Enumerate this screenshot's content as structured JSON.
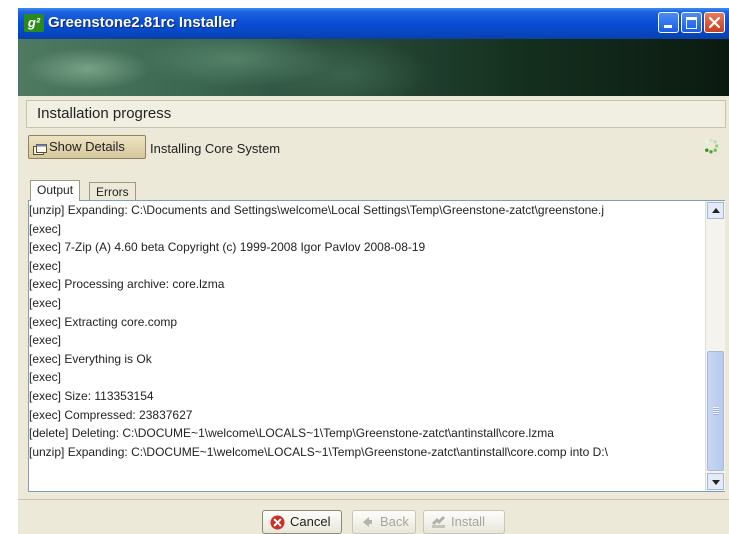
{
  "window": {
    "title": "Greenstone2.81rc Installer",
    "app_icon_text": "g²"
  },
  "heading": "Installation progress",
  "details_button_label": "Show Details",
  "status_text": "Installing Core System",
  "tabs": [
    {
      "label": "Output",
      "selected": true
    },
    {
      "label": "Errors",
      "selected": false
    }
  ],
  "log_lines": [
    "[unzip] Expanding: C:\\Documents and Settings\\welcome\\Local Settings\\Temp\\Greenstone-zatct\\greenstone.j",
    "  [exec]",
    "  [exec] 7-Zip (A)  4.60 beta  Copyright (c) 1999-2008 Igor Pavlov  2008-08-19",
    "  [exec]",
    "  [exec] Processing archive: core.lzma",
    "  [exec]",
    "  [exec] Extracting  core.comp",
    "  [exec]",
    "  [exec] Everything is Ok",
    "  [exec]",
    "  [exec] Size:      113353154",
    "  [exec] Compressed: 23837627",
    " [delete] Deleting: C:\\DOCUME~1\\welcome\\LOCALS~1\\Temp\\Greenstone-zatct\\antinstall\\core.lzma",
    "  [unzip] Expanding: C:\\DOCUME~1\\welcome\\LOCALS~1\\Temp\\Greenstone-zatct\\antinstall\\core.comp into D:\\"
  ],
  "buttons": {
    "cancel": "Cancel",
    "back": "Back",
    "install": "Install"
  },
  "colors": {
    "titlebar": "#0a4fd6",
    "cancel_icon": "#c8302a",
    "disabled_text": "#a6a6a0"
  },
  "icons": {
    "details": "details-window-icon",
    "spinner": "busy-spinner-icon",
    "cancel": "cancel-x-icon",
    "back": "back-arrow-icon",
    "install": "install-icon"
  }
}
